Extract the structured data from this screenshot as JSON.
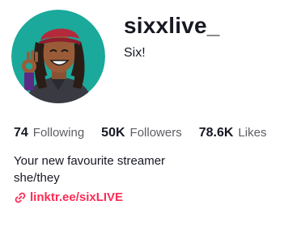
{
  "profile": {
    "username": "sixxlive_",
    "nickname": "Six!",
    "avatar_icon": "streamer-avatar"
  },
  "stats": [
    {
      "value": "74",
      "label": "Following"
    },
    {
      "value": "50K",
      "label": "Followers"
    },
    {
      "value": "78.6K",
      "label": "Likes"
    }
  ],
  "bio": {
    "lines": [
      "Your new favourite streamer",
      "she/they"
    ]
  },
  "link": {
    "text": "linktr.ee/sixLIVE",
    "icon": "link-icon",
    "color": "#fe2c55"
  },
  "colors": {
    "avatar_bg": "#1aa99a",
    "accent": "#fe2c55",
    "text": "#161823",
    "muted": "#5c5d63"
  }
}
